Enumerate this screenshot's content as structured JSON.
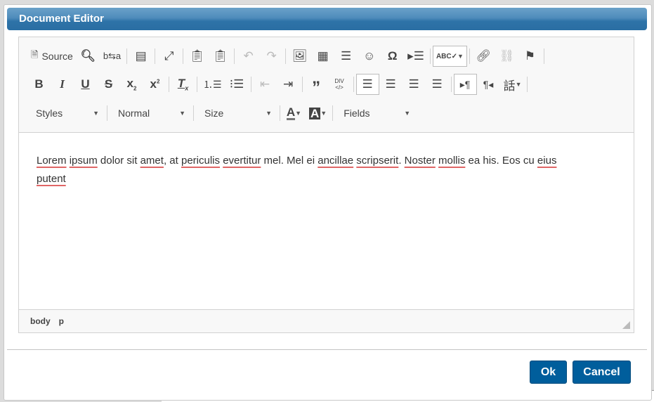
{
  "dialog": {
    "title": "Document Editor"
  },
  "toolbar": {
    "source_label": "Source",
    "styles": "Styles",
    "format": "Normal",
    "size": "Size",
    "fields": "Fields"
  },
  "content": {
    "words": [
      "Lorem",
      "ipsum",
      "dolor sit",
      "amet",
      ", at",
      "periculis",
      "evertitur",
      "mel. Mel ei",
      "ancillae",
      "scripserit",
      ".",
      "Noster",
      "mollis",
      "ea his. Eos cu",
      "eius",
      "putent"
    ]
  },
  "statusbar": {
    "path": [
      "body",
      "p"
    ]
  },
  "buttons": {
    "ok": "Ok",
    "cancel": "Cancel"
  },
  "colors": {
    "title": "#2e73a8",
    "button": "#005e9c",
    "spell": "#e06666"
  }
}
